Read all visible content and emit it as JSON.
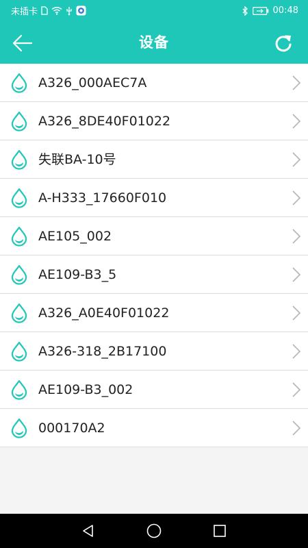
{
  "status_bar": {
    "carrier": "未插卡",
    "time": "00:48",
    "icons": [
      "sim-doc-icon",
      "wifi-icon",
      "usb-icon",
      "app-notification-icon",
      "bluetooth-icon",
      "battery-charging-icon"
    ]
  },
  "app_bar": {
    "title": "设备",
    "back_icon": "arrow-left-icon",
    "refresh_icon": "refresh-icon"
  },
  "devices": [
    {
      "name": "A326_000AEC7A"
    },
    {
      "name": "A326_8DE40F01022"
    },
    {
      "name": "失联BA-10号"
    },
    {
      "name": "A-H333_17660F010"
    },
    {
      "name": "AE105_002"
    },
    {
      "name": "AE109-B3_5"
    },
    {
      "name": "A326_A0E40F01022"
    },
    {
      "name": "A326-318_2B17100"
    },
    {
      "name": "AE109-B3_002"
    },
    {
      "name": "000170A2"
    }
  ],
  "colors": {
    "accent": "#1fc7b9",
    "row_bg": "#ffffff",
    "divider": "#dcdcdc",
    "chevron": "#b5b5b5"
  },
  "nav_bar": {
    "buttons": [
      "back-triangle-icon",
      "home-circle-icon",
      "recents-square-icon"
    ]
  }
}
